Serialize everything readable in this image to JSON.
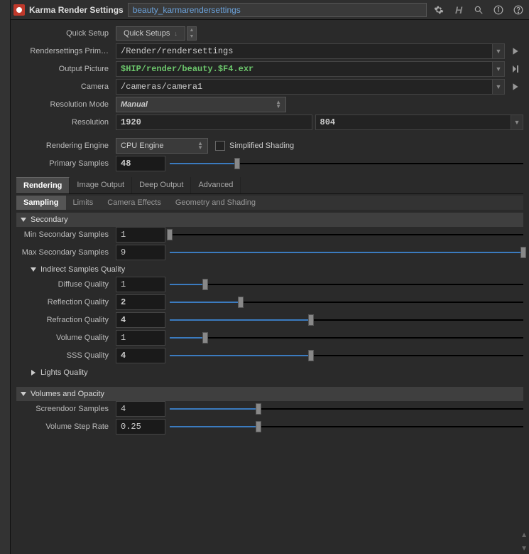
{
  "titlebar": {
    "title": "Karma Render Settings",
    "name": "beauty_karmarendersettings"
  },
  "params": {
    "quick_setup_label": "Quick Setup",
    "quick_setup_value": "Quick Setups",
    "rendersettings_primpath_label": "Rendersettings Prim…",
    "rendersettings_primpath_value": "/Render/rendersettings",
    "output_picture_label": "Output Picture",
    "output_picture_value": "$HIP/render/beauty.$F4.exr",
    "camera_label": "Camera",
    "camera_value": "/cameras/camera1",
    "resolution_mode_label": "Resolution Mode",
    "resolution_mode_value": "Manual",
    "resolution_label": "Resolution",
    "resolution_x": "1920",
    "resolution_y": "804",
    "rendering_engine_label": "Rendering Engine",
    "rendering_engine_value": "CPU Engine",
    "simplified_shading_label": "Simplified Shading",
    "primary_samples_label": "Primary Samples",
    "primary_samples_value": "48"
  },
  "tabs": {
    "rendering": "Rendering",
    "image_output": "Image Output",
    "deep_output": "Deep Output",
    "advanced": "Advanced"
  },
  "subtabs": {
    "sampling": "Sampling",
    "limits": "Limits",
    "camera_effects": "Camera Effects",
    "geometry_shading": "Geometry and Shading"
  },
  "sections": {
    "secondary_title": "Secondary",
    "min_secondary_label": "Min Secondary Samples",
    "min_secondary_value": "1",
    "max_secondary_label": "Max Secondary Samples",
    "max_secondary_value": "9",
    "indirect_title": "Indirect Samples Quality",
    "diffuse_quality_label": "Diffuse Quality",
    "diffuse_quality_value": "1",
    "reflection_quality_label": "Reflection Quality",
    "reflection_quality_value": "2",
    "refraction_quality_label": "Refraction Quality",
    "refraction_quality_value": "4",
    "volume_quality_label": "Volume Quality",
    "volume_quality_value": "1",
    "sss_quality_label": "SSS Quality",
    "sss_quality_value": "4",
    "lights_quality_title": "Lights Quality",
    "volumes_opacity_title": "Volumes and Opacity",
    "screendoor_label": "Screendoor Samples",
    "screendoor_value": "4",
    "volume_step_label": "Volume Step Rate",
    "volume_step_value": "0.25"
  }
}
